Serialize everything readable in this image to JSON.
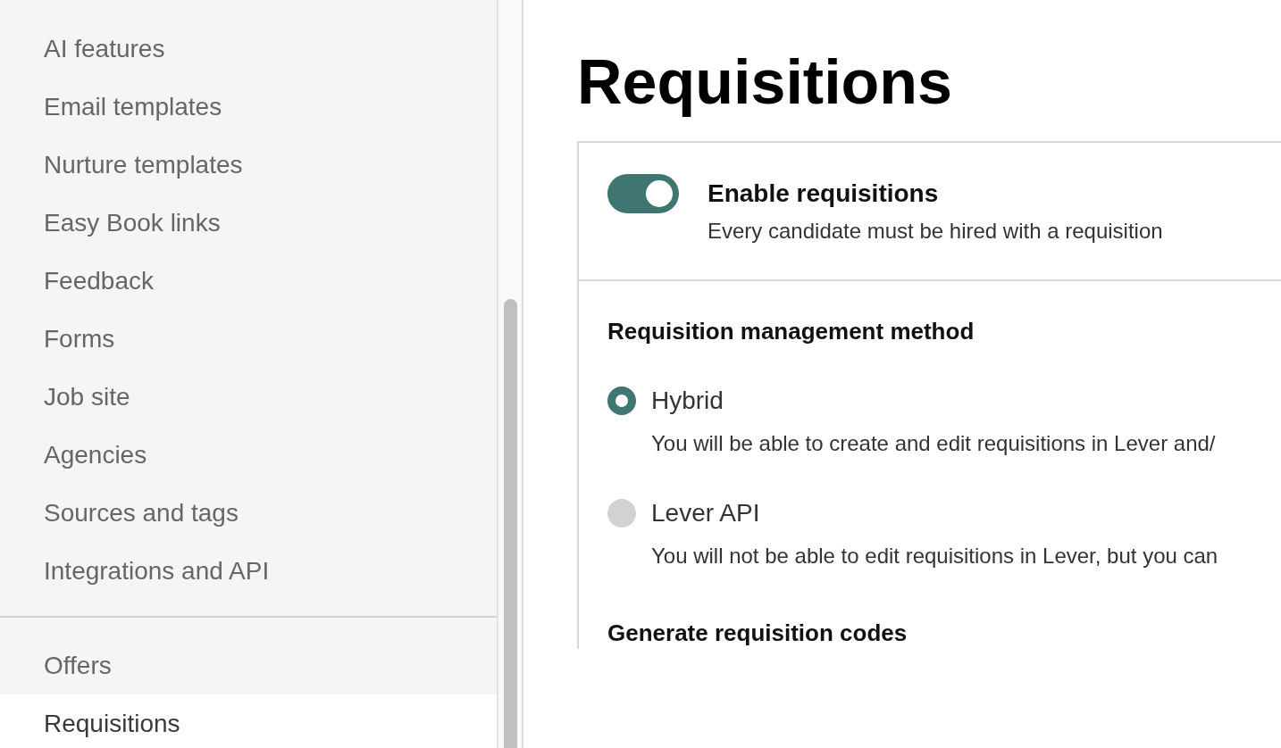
{
  "sidebar": {
    "groups": [
      {
        "items": [
          {
            "label": "AI features",
            "selected": false
          },
          {
            "label": "Email templates",
            "selected": false
          },
          {
            "label": "Nurture templates",
            "selected": false
          },
          {
            "label": "Easy Book links",
            "selected": false
          },
          {
            "label": "Feedback",
            "selected": false
          },
          {
            "label": "Forms",
            "selected": false
          },
          {
            "label": "Job site",
            "selected": false
          },
          {
            "label": "Agencies",
            "selected": false
          },
          {
            "label": "Sources and tags",
            "selected": false
          },
          {
            "label": "Integrations and API",
            "selected": false
          }
        ]
      },
      {
        "items": [
          {
            "label": "Offers",
            "selected": false
          },
          {
            "label": "Requisitions",
            "selected": true
          }
        ]
      }
    ]
  },
  "page_title": "Requisitions",
  "enable_toggle": {
    "label": "Enable requisitions",
    "description": "Every candidate must be hired with a requisition",
    "on": true
  },
  "management_method": {
    "heading": "Requisition management method",
    "options": [
      {
        "label": "Hybrid",
        "description": "You will be able to create and edit requisitions in Lever and/",
        "selected": true
      },
      {
        "label": "Lever API",
        "description": "You will not be able to edit requisitions in Lever, but you can",
        "selected": false
      }
    ]
  },
  "next_heading": "Generate requisition codes"
}
